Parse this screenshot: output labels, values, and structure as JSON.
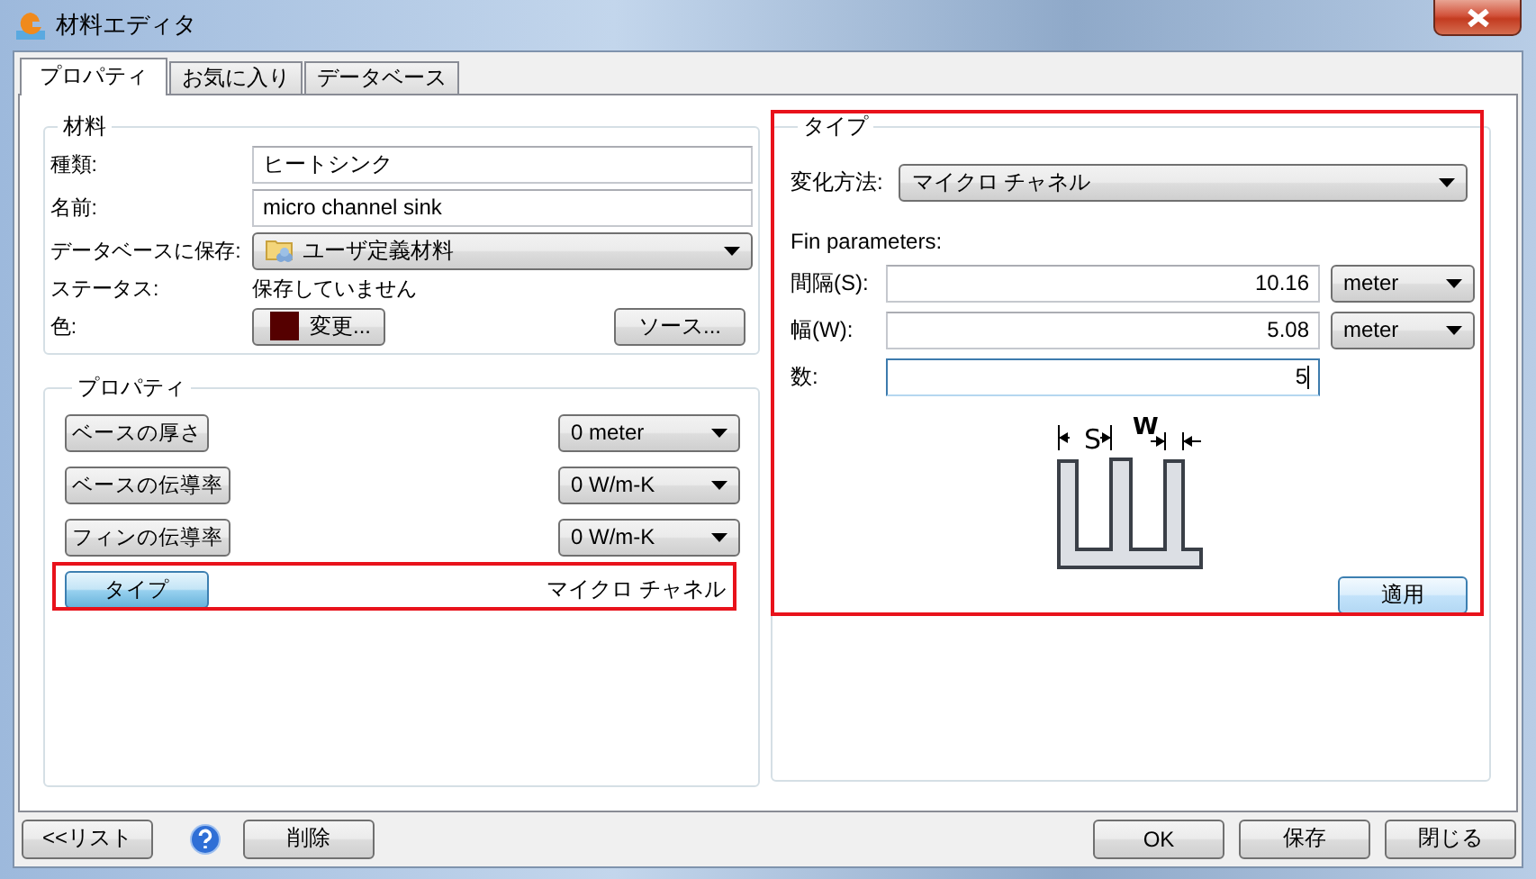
{
  "window": {
    "title": "材料エディタ"
  },
  "tabs": [
    {
      "label": "プロパティ",
      "selected": true
    },
    {
      "label": "お気に入り",
      "selected": false
    },
    {
      "label": "データベース",
      "selected": false
    }
  ],
  "material": {
    "title": "材料",
    "type_label": "種類:",
    "type_value": "ヒートシンク",
    "name_label": "名前:",
    "name_value": "micro channel sink",
    "database_label": "データベースに保存:",
    "database_value": "ユーザ定義材料",
    "status_label": "ステータス:",
    "status_value": "保存していません",
    "color_label": "色:",
    "color": "#550000",
    "color_button": "変更...",
    "source_button": "ソース..."
  },
  "properties": {
    "title": "プロパティ",
    "rows": [
      {
        "kind": "combo",
        "button": "ベースの厚さ",
        "value": "0 meter",
        "selected": false,
        "highlighted": false
      },
      {
        "kind": "combo",
        "button": "ベースの伝導率",
        "value": "0 W/m-K",
        "selected": false,
        "highlighted": false
      },
      {
        "kind": "combo",
        "button": "フィンの伝導率",
        "value": "0 W/m-K",
        "selected": false,
        "highlighted": false
      },
      {
        "kind": "text",
        "button": "タイプ",
        "value": "マイクロ チャネル",
        "selected": true,
        "highlighted": true
      }
    ]
  },
  "type_group": {
    "title": "タイプ",
    "highlighted": true,
    "method_label": "変化方法:",
    "method_value": "マイクロ チャネル",
    "fin_title": "Fin parameters:",
    "params": [
      {
        "kind": "unit",
        "label": "間隔(S):",
        "value": "10.16",
        "unit": "meter",
        "focused": false
      },
      {
        "kind": "unit",
        "label": "幅(W):",
        "value": "5.08",
        "unit": "meter",
        "focused": false
      },
      {
        "kind": "plain",
        "label": "数:",
        "value": "5",
        "focused": true
      }
    ],
    "diagram": {
      "s_label": "S",
      "w_label": "W"
    },
    "apply_button": "適用"
  },
  "footer": {
    "list_button": "<<リスト",
    "delete_button": "削除",
    "ok_button": "OK",
    "save_button": "保存",
    "close_button": "閉じる"
  }
}
